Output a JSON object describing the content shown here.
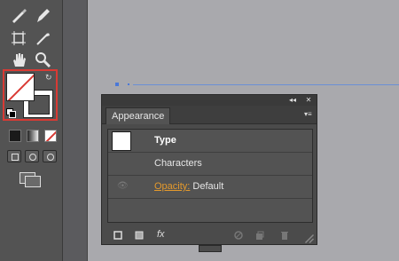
{
  "panel": {
    "tab_label": "Appearance",
    "title_controls": {
      "collapse": "◂◂",
      "close": "✕"
    },
    "rows": {
      "type_label": "Type",
      "characters_label": "Characters",
      "opacity_link": "Opacity:",
      "opacity_value": "Default"
    },
    "footer": {
      "fx_label": "fx"
    }
  },
  "tools": {
    "fill_color": "#ffffff",
    "stroke_color": "#ffffff",
    "none_swatch_color": "#d93a34",
    "accent_color": "#6b8fd6"
  }
}
